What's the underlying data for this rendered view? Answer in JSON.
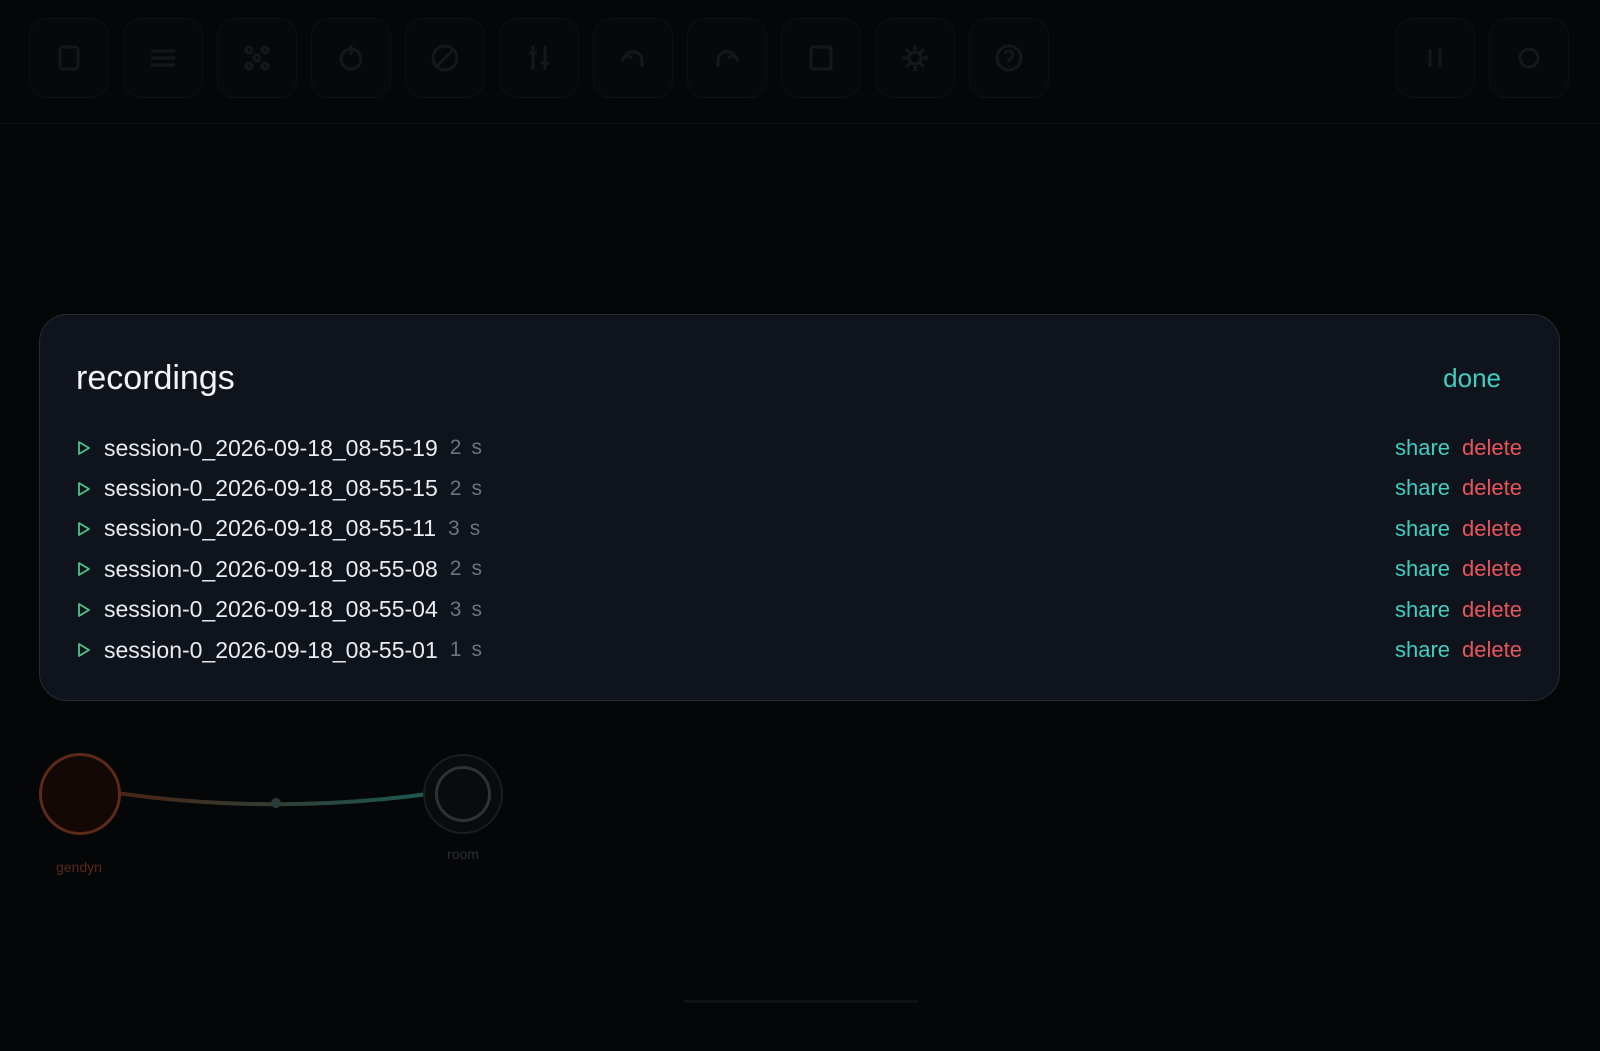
{
  "toolbar": {
    "left_icons": [
      "stop-icon",
      "list-icon",
      "nodes-icon",
      "power-icon",
      "disabled-icon",
      "mixer-icon",
      "undo-icon",
      "redo-icon",
      "book-icon",
      "gear-icon",
      "help-icon"
    ],
    "right_icons": [
      "pause-icon",
      "record-icon"
    ]
  },
  "canvas": {
    "nodes": [
      {
        "label": "gendyn",
        "color": "#7a3a22"
      },
      {
        "label": "room",
        "color": "#3b3f44"
      }
    ]
  },
  "modal": {
    "title": "recordings",
    "done_label": "done",
    "recordings": [
      {
        "name": "session-0_2026-09-18_08-55-19",
        "duration": "2",
        "unit": "s",
        "share_label": "share",
        "delete_label": "delete"
      },
      {
        "name": "session-0_2026-09-18_08-55-15",
        "duration": "2",
        "unit": "s",
        "share_label": "share",
        "delete_label": "delete"
      },
      {
        "name": "session-0_2026-09-18_08-55-11",
        "duration": "3",
        "unit": "s",
        "share_label": "share",
        "delete_label": "delete"
      },
      {
        "name": "session-0_2026-09-18_08-55-08",
        "duration": "2",
        "unit": "s",
        "share_label": "share",
        "delete_label": "delete"
      },
      {
        "name": "session-0_2026-09-18_08-55-04",
        "duration": "3",
        "unit": "s",
        "share_label": "share",
        "delete_label": "delete"
      },
      {
        "name": "session-0_2026-09-18_08-55-01",
        "duration": "1",
        "unit": "s",
        "share_label": "share",
        "delete_label": "delete"
      }
    ]
  },
  "colors": {
    "accent": "#3ecfc2",
    "danger": "#e9545b",
    "play": "#4cc28a"
  }
}
